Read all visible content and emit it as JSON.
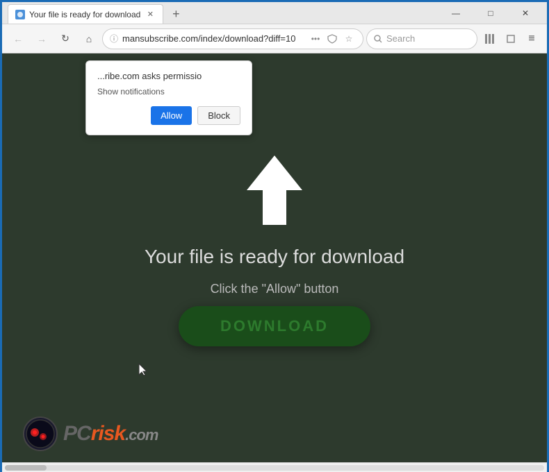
{
  "window": {
    "title": "Your file is ready for download",
    "controls": {
      "minimize": "—",
      "maximize": "□",
      "close": "✕"
    }
  },
  "tab": {
    "label": "Your file is ready for download",
    "close": "✕"
  },
  "new_tab_button": "+",
  "nav": {
    "back": "←",
    "forward": "→",
    "refresh": "↻",
    "home": "⌂",
    "address": "mansubscribe.com/index/download?diff=10",
    "lock_icon": "ⓘ",
    "more_icon": "•••",
    "shield_icon": "🛡",
    "star_icon": "☆",
    "search_placeholder": "Search",
    "bookmarks_icon": "|||",
    "addons_icon": "□",
    "menu_icon": "≡"
  },
  "permission_popup": {
    "title": "...ribe.com asks permissio",
    "subtitle": "Show notifications",
    "allow_label": "Allow",
    "block_label": "Block"
  },
  "page": {
    "main_title": "Your file is ready for download",
    "instruction": "Click the \"Allow\" button",
    "download_label": "DOWNLOAD"
  },
  "pcrisk": {
    "pc_text": "PC",
    "risk_text": "risk",
    "com_text": ".com"
  }
}
